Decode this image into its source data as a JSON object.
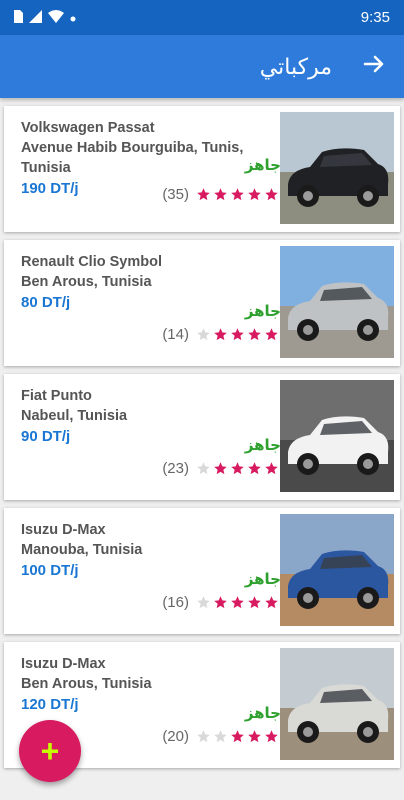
{
  "status_bar": {
    "time": "9:35"
  },
  "app_bar": {
    "title": "مركباتي",
    "back_icon": "arrow-right-icon"
  },
  "colors": {
    "primary": "#2e7bdb",
    "accent": "#d81b60",
    "price": "#1976d2",
    "available": "#2ea02e",
    "star_on": "#d81b60",
    "star_off": "#d9d9d9"
  },
  "cars": [
    {
      "name": "Volkswagen Passat",
      "location": "Avenue Habib Bourguiba, Tunis, Tunisia",
      "price": "190 DT/j",
      "status": "جاهز",
      "reviews": "(35)",
      "stars": 5
    },
    {
      "name": "Renault Clio Symbol",
      "location": "Ben Arous, Tunisia",
      "price": "80 DT/j",
      "status": "جاهز",
      "reviews": "(14)",
      "stars": 4
    },
    {
      "name": "Fiat Punto",
      "location": "Nabeul, Tunisia",
      "price": "90 DT/j",
      "status": "جاهز",
      "reviews": "(23)",
      "stars": 4
    },
    {
      "name": "Isuzu D-Max",
      "location": "Manouba, Tunisia",
      "price": "100 DT/j",
      "status": "جاهز",
      "reviews": "(16)",
      "stars": 4
    },
    {
      "name": "Isuzu D-Max",
      "location": "Ben Arous, Tunisia",
      "price": "120 DT/j",
      "status": "جاهز",
      "reviews": "(20)",
      "stars": 3
    }
  ],
  "fab": {
    "label": "+",
    "icon": "plus-icon"
  }
}
